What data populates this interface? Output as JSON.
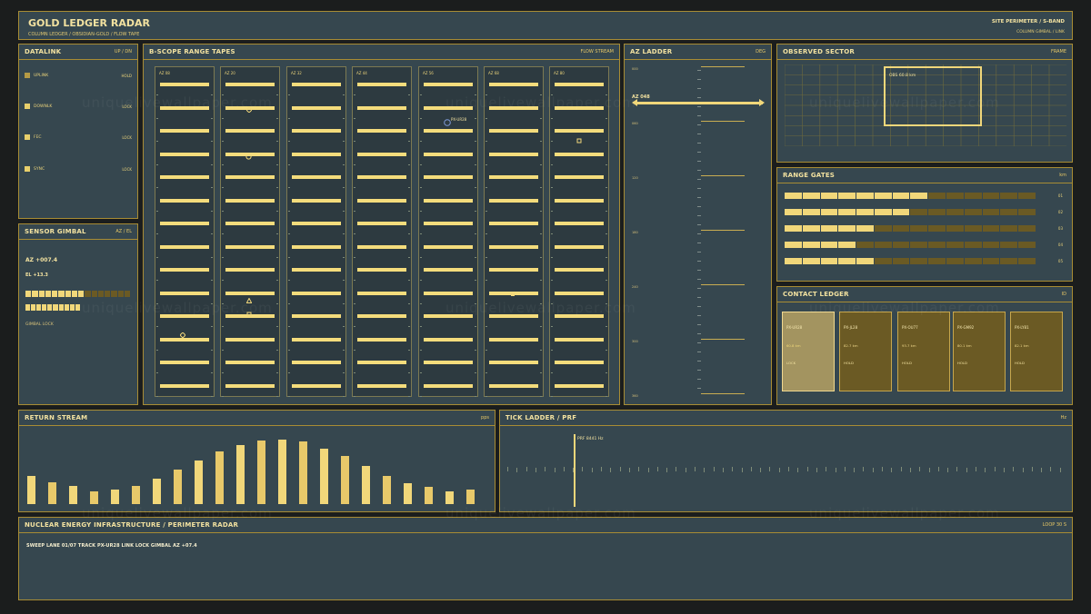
{
  "banner": {
    "title": "GOLD LEDGER RADAR",
    "subtitle": "COLUMN LEDGER / OBSIDIAN-GOLD / FLOW TAPE",
    "right_title": "SITE PERIMETER / S-BAND",
    "right_sub": "COLUMN GIMBAL / LINK"
  },
  "datalink": {
    "title": "DATALINK",
    "tag": "UP / DN",
    "rows": [
      {
        "label": "UPLINK",
        "status": "HOLD"
      },
      {
        "label": "DOWNLK",
        "status": "LOCK"
      },
      {
        "label": "FEC",
        "status": "LOCK"
      },
      {
        "label": "SYNC",
        "status": "LOCK"
      }
    ]
  },
  "gimbal": {
    "title": "SENSOR GIMBAL",
    "tag": "AZ / EL",
    "az": "AZ +007.4",
    "el": "EL +13.3",
    "az_level": 0.55,
    "el_level": 0.5,
    "status": "GIMBAL LOCK"
  },
  "bscope": {
    "title": "B-SCOPE RANGE TAPES",
    "tag": "FLOW STREAM",
    "lanes": [
      "AZ 08",
      "AZ 20",
      "AZ 32",
      "AZ 44",
      "AZ 56",
      "AZ 68",
      "AZ 80"
    ],
    "contact_label": "PX-UR28"
  },
  "azladder": {
    "title": "AZ LADDER",
    "tag": "DEG",
    "marker": "AZ 048",
    "labels": [
      "000",
      "060",
      "120",
      "180",
      "240",
      "300",
      "360"
    ]
  },
  "sector": {
    "title": "OBSERVED SECTOR",
    "tag": "FRAME",
    "box_label": "OBS 60.8 km"
  },
  "gates": {
    "title": "RANGE GATES",
    "tag": "km",
    "items": [
      {
        "label": "01",
        "level": 0.57
      },
      {
        "label": "02",
        "level": 0.5
      },
      {
        "label": "03",
        "level": 0.36
      },
      {
        "label": "04",
        "level": 0.29
      },
      {
        "label": "05",
        "level": 0.36
      }
    ]
  },
  "contacts": {
    "title": "CONTACT LEDGER",
    "tag": "ID",
    "items": [
      {
        "id": "PX-UR28",
        "range": "60.8 km",
        "status": "LOCK"
      },
      {
        "id": "PX-JL28",
        "range": "82.7 km",
        "status": "HOLD"
      },
      {
        "id": "PX-OU77",
        "range": "93.7 km",
        "status": "HOLD"
      },
      {
        "id": "PX-GM92",
        "range": "80.1 km",
        "status": "HOLD"
      },
      {
        "id": "PX-LY81",
        "range": "82.1 km",
        "status": "HOLD"
      }
    ]
  },
  "returns": {
    "title": "RETURN STREAM",
    "tag": "pps",
    "values": [
      28,
      22,
      18,
      13,
      14,
      18,
      25,
      34,
      43,
      52,
      58,
      63,
      64,
      62,
      55,
      48,
      38,
      28,
      21,
      17,
      13,
      14
    ]
  },
  "ticks": {
    "title": "TICK LADDER / PRF",
    "tag": "Hz",
    "label": "PRF 8441 Hz"
  },
  "footer": {
    "title": "NUCLEAR ENERGY INFRASTRUCTURE / PERIMETER RADAR",
    "tag": "LOOP 30 S",
    "status": "SWEEP LANE 01/07  TRACK PX-UR28  LINK LOCK  GIMBAL AZ +07.4"
  },
  "watermark": "uniquelivewallpaper.com"
}
